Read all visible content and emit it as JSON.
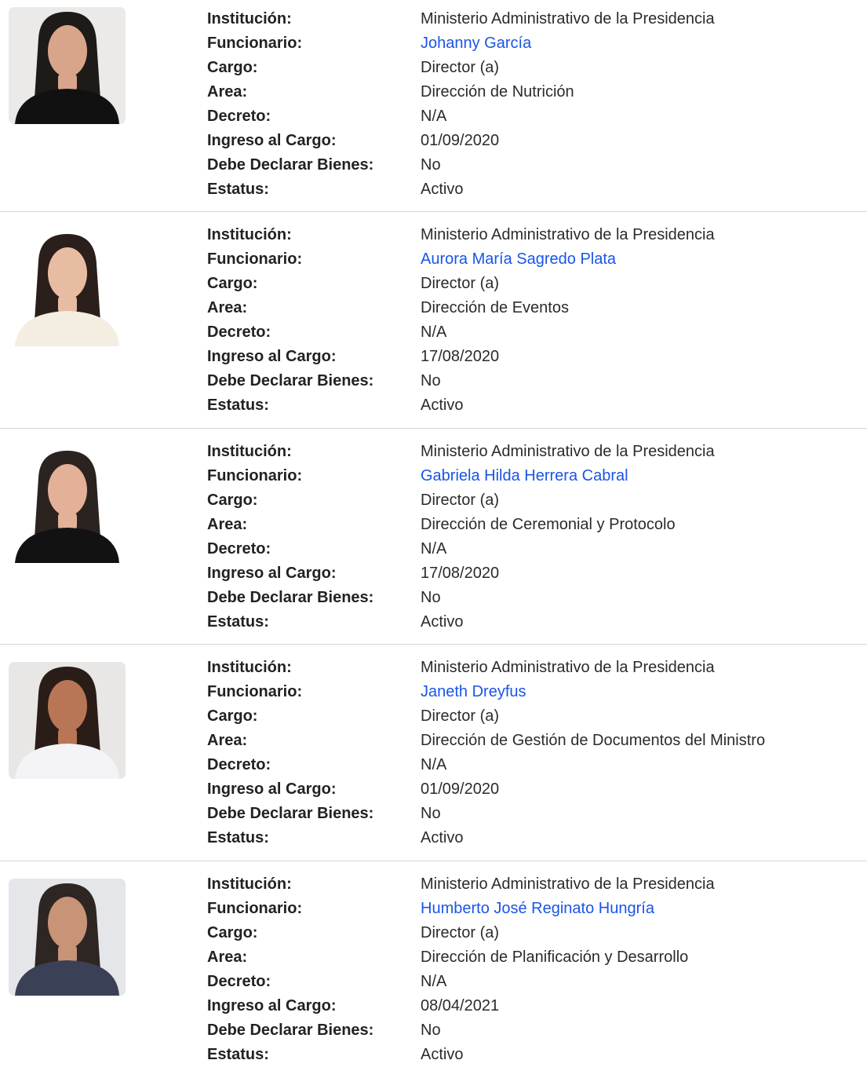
{
  "labels": {
    "institucion": "Institución:",
    "funcionario": "Funcionario:",
    "cargo": "Cargo:",
    "area": "Area:",
    "decreto": "Decreto:",
    "ingreso": "Ingreso al Cargo:",
    "bienes": "Debe Declarar Bienes:",
    "estatus": "Estatus:"
  },
  "colors": {
    "link": "#1a55e8",
    "divider": "#d9d9d9"
  },
  "officials": [
    {
      "institucion": "Ministerio Administrativo de la Presidencia",
      "funcionario": "Johanny García",
      "cargo": "Director (a)",
      "area": "Dirección de Nutrición",
      "decreto": "N/A",
      "ingreso": "01/09/2020",
      "bienes": "No",
      "estatus": "Activo",
      "photo": {
        "bg": "#eceae8",
        "skin": "#d9a58a",
        "hair": "#1e1a18",
        "clothing": "#111111",
        "icon": "person-photo-icon"
      }
    },
    {
      "institucion": "Ministerio Administrativo de la Presidencia",
      "funcionario": "Aurora María Sagredo Plata",
      "cargo": "Director (a)",
      "area": "Dirección de Eventos",
      "decreto": "N/A",
      "ingreso": "17/08/2020",
      "bienes": "No",
      "estatus": "Activo",
      "photo": {
        "bg": "#ffffff",
        "skin": "#e7bca3",
        "hair": "#2a1f1a",
        "clothing": "#f4ede2",
        "icon": "person-photo-icon"
      }
    },
    {
      "institucion": "Ministerio Administrativo de la Presidencia",
      "funcionario": "Gabriela Hilda Herrera Cabral",
      "cargo": "Director (a)",
      "area": "Dirección de Ceremonial y Protocolo",
      "decreto": "N/A",
      "ingreso": "17/08/2020",
      "bienes": "No",
      "estatus": "Activo",
      "photo": {
        "bg": "#ffffff",
        "skin": "#e2b198",
        "hair": "#2b2320",
        "clothing": "#121212",
        "icon": "person-photo-icon"
      }
    },
    {
      "institucion": "Ministerio Administrativo de la Presidencia",
      "funcionario": "Janeth Dreyfus",
      "cargo": "Director (a)",
      "area": "Dirección de Gestión de Documentos del Ministro",
      "decreto": "N/A",
      "ingreso": "01/09/2020",
      "bienes": "No",
      "estatus": "Activo",
      "photo": {
        "bg": "#e9e7e5",
        "skin": "#b87656",
        "hair": "#2a1d18",
        "clothing": "#f4f4f6",
        "icon": "person-photo-icon"
      }
    },
    {
      "institucion": "Ministerio Administrativo de la Presidencia",
      "funcionario": "Humberto José Reginato Hungría",
      "cargo": "Director (a)",
      "area": "Dirección de Planificación y Desarrollo",
      "decreto": "N/A",
      "ingreso": "08/04/2021",
      "bienes": "No",
      "estatus": "Activo",
      "photo": {
        "bg": "#e4e6ea",
        "skin": "#c99377",
        "hair": "#2e2622",
        "clothing": "#3a4156",
        "icon": "person-photo-icon"
      }
    }
  ]
}
